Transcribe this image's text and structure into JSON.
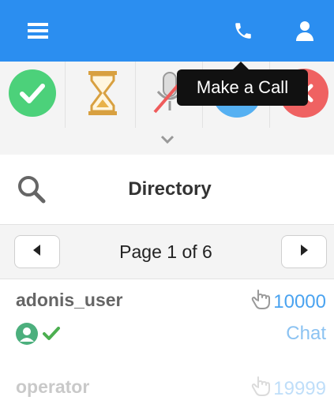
{
  "topbar": {
    "menu_icon": "hamburger-menu-icon",
    "call_icon": "phone-icon",
    "user_icon": "user-icon",
    "color": "#2b8ef0"
  },
  "status_bar": {
    "items": [
      {
        "icon": "available-check-icon",
        "color": "#4cd17a"
      },
      {
        "icon": "hourglass-icon",
        "color": "#e8b24a"
      },
      {
        "icon": "microphone-muted-icon",
        "color": "#ef5b5b"
      },
      {
        "icon": "status-blue-icon",
        "color": "#55b0f2"
      },
      {
        "icon": "status-red-icon",
        "color": "#ef5b5b"
      }
    ],
    "expand_icon": "chevron-down-icon"
  },
  "tooltip": {
    "text": "Make a Call"
  },
  "directory": {
    "title": "Directory",
    "search_icon": "search-icon"
  },
  "pager": {
    "label": "Page 1 of 6",
    "prev_icon": "prev-arrow-icon",
    "next_icon": "next-arrow-icon"
  },
  "entries": [
    {
      "name": "adonis_user",
      "extension": "10000",
      "chat": "Chat",
      "status": "available"
    },
    {
      "name": "operator",
      "extension": "19999"
    }
  ]
}
